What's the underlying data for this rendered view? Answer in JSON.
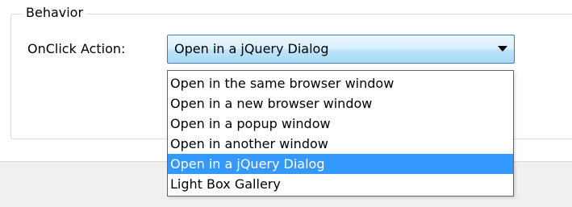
{
  "behavior_group": {
    "legend": "Behavior",
    "onclick_label": "OnClick Action:"
  },
  "combo": {
    "selected_value": "Open in a jQuery Dialog",
    "arrow_icon": "chevron-down-icon"
  },
  "dropdown": {
    "items": [
      {
        "label": "Open in the same browser window",
        "selected": false
      },
      {
        "label": "Open in a new browser window",
        "selected": false
      },
      {
        "label": "Open in a popup window",
        "selected": false
      },
      {
        "label": "Open in another window",
        "selected": false
      },
      {
        "label": "Open in a jQuery Dialog",
        "selected": true
      },
      {
        "label": "Light Box Gallery",
        "selected": false
      }
    ],
    "highlight_color": "#3399ff"
  }
}
